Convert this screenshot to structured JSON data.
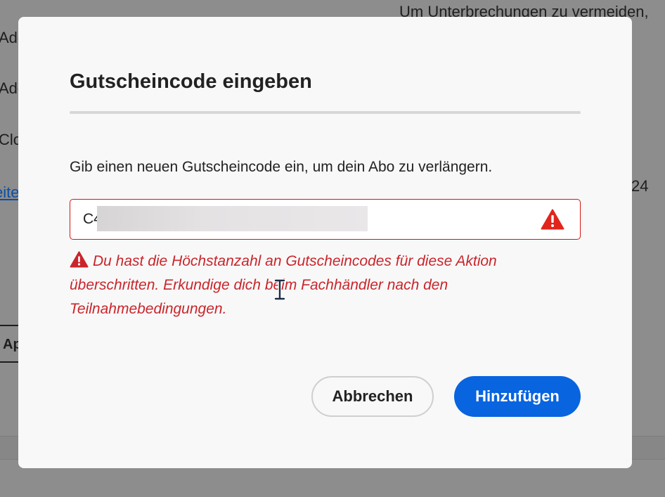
{
  "background": {
    "notice_text": "Um Unterbrechungen zu vermeiden,",
    "row_labels": [
      "Ado",
      "Ado",
      "Clo"
    ],
    "link_fragment": "eite",
    "year_fragment": "24",
    "tab_label": "Ap"
  },
  "dialog": {
    "title": "Gutscheincode eingeben",
    "description": "Gib einen neuen Gutscheincode ein, um dein Abo zu verlängern.",
    "code_input": {
      "value": "C4",
      "placeholder": ""
    },
    "error_message": "Du hast die Höchstanzahl an Gutscheincodes für diese Aktion überschritten. Erkundige dich beim Fachhändler nach den Teilnahmebedingungen.",
    "cancel_label": "Abbrechen",
    "add_label": "Hinzufügen"
  },
  "icons": {
    "field_alert": "alert-triangle-icon",
    "message_alert": "alert-triangle-icon",
    "cursor": "text-cursor-icon"
  },
  "colors": {
    "error": "#d31510",
    "error_text": "#c9252b",
    "primary": "#0864df",
    "overlay": "#8d8d8d"
  }
}
